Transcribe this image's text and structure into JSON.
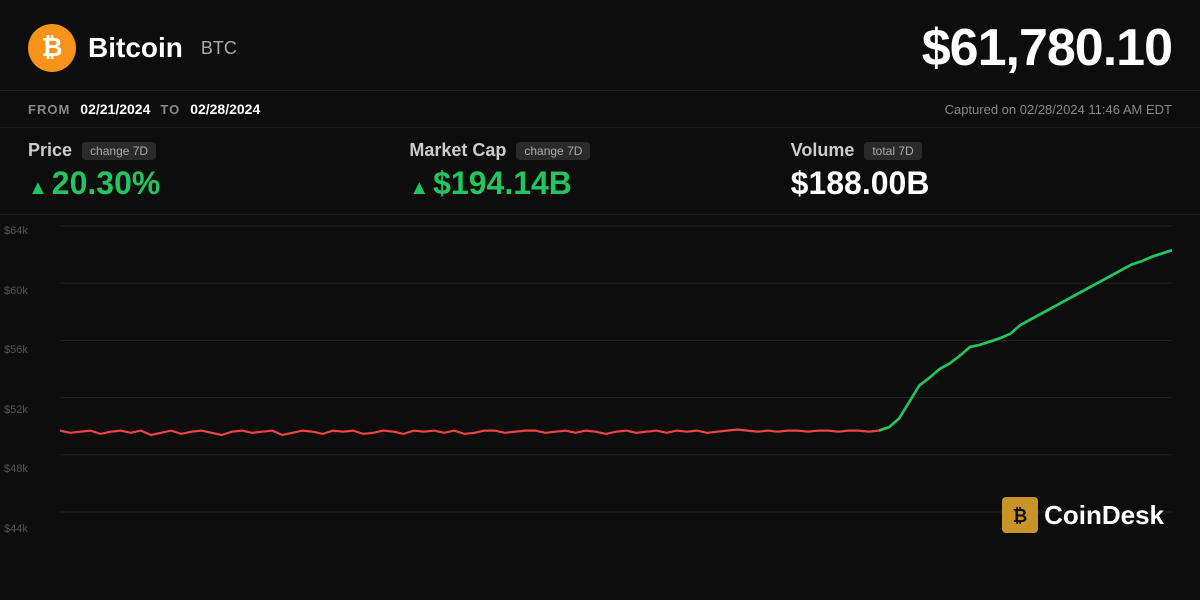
{
  "header": {
    "coin_name": "Bitcoin",
    "coin_ticker": "BTC",
    "current_price": "$61,780.10"
  },
  "date_range": {
    "from_label": "FROM",
    "from_date": "02/21/2024",
    "to_label": "TO",
    "to_date": "02/28/2024",
    "captured_text": "Captured on 02/28/2024 11:46 AM EDT"
  },
  "stats": {
    "price": {
      "name": "Price",
      "badge": "change 7D",
      "value": "20.30%",
      "arrow": "▲"
    },
    "market_cap": {
      "name": "Market Cap",
      "badge": "change 7D",
      "value": "$194.14B",
      "arrow": "▲"
    },
    "volume": {
      "name": "Volume",
      "badge": "total 7D",
      "value": "$188.00B"
    }
  },
  "chart": {
    "y_labels": [
      "$64k",
      "$60k",
      "$56k",
      "$52k",
      "$48k",
      "$44k"
    ],
    "y_values": [
      64000,
      60000,
      56000,
      52000,
      48000,
      44000
    ]
  },
  "branding": {
    "coindesk_label": "CoinDesk"
  }
}
